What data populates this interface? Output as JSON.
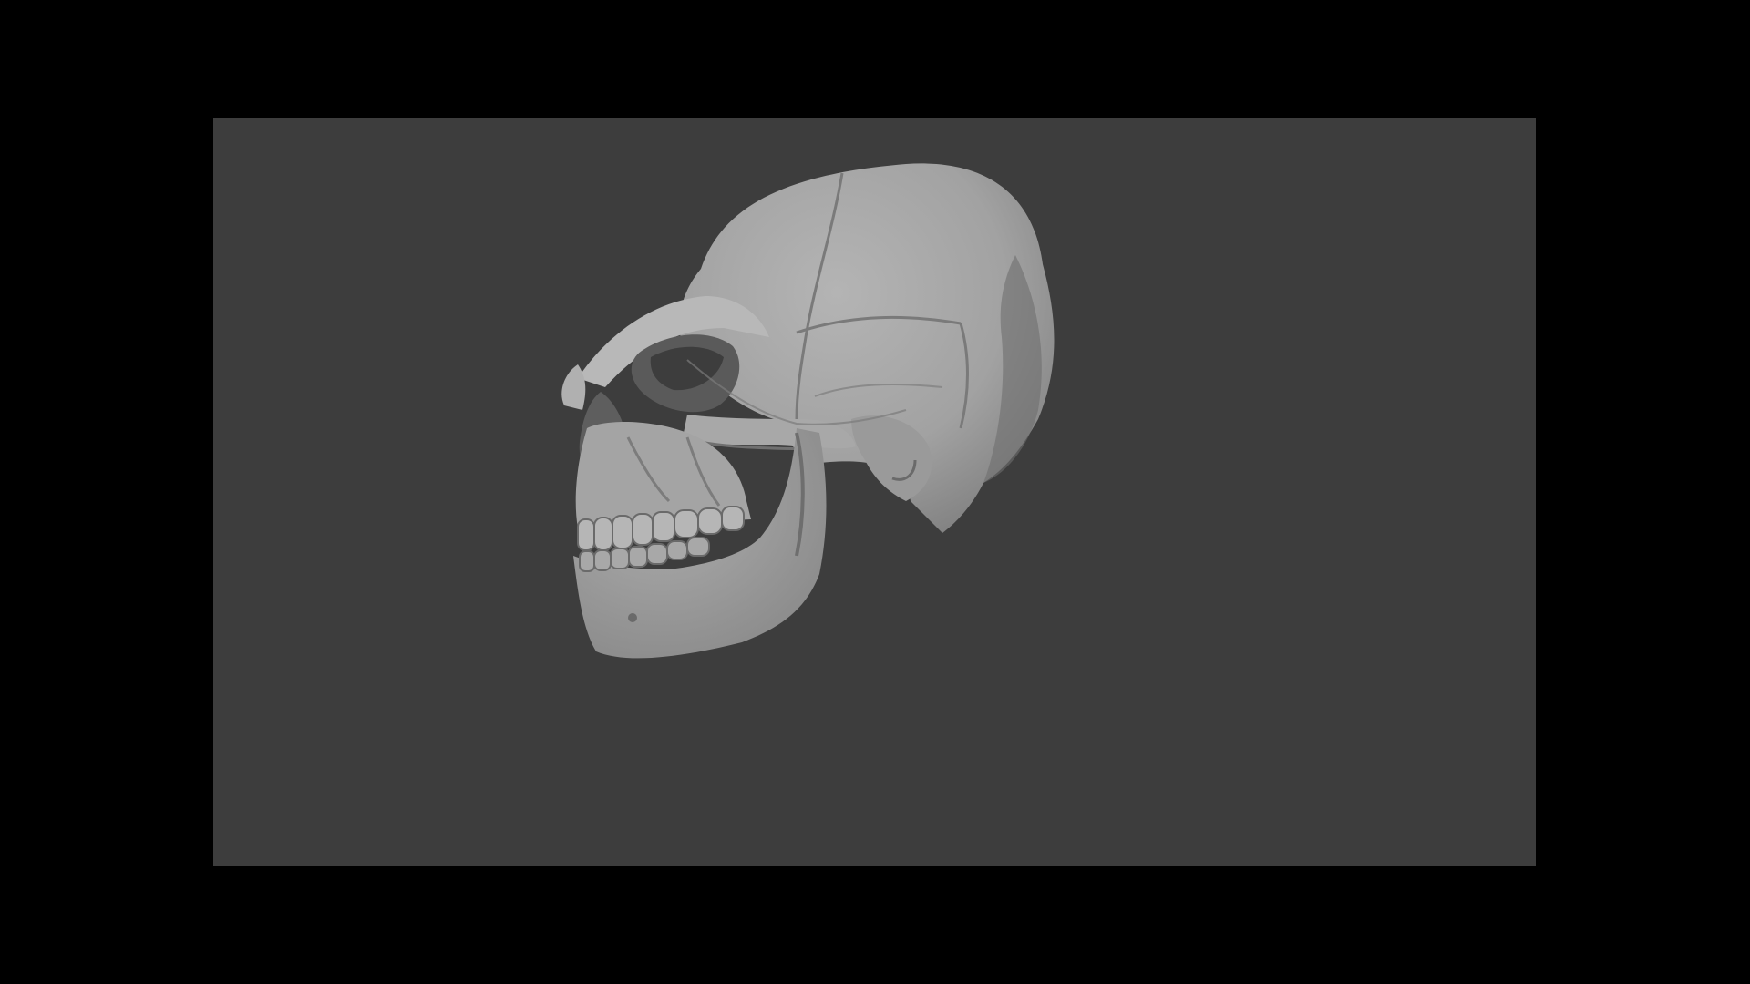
{
  "viewport": {
    "background_color": "#3d3d3d",
    "letterbox_color": "#000000",
    "model_color": "#a6a6a6",
    "model": "skull-model"
  }
}
